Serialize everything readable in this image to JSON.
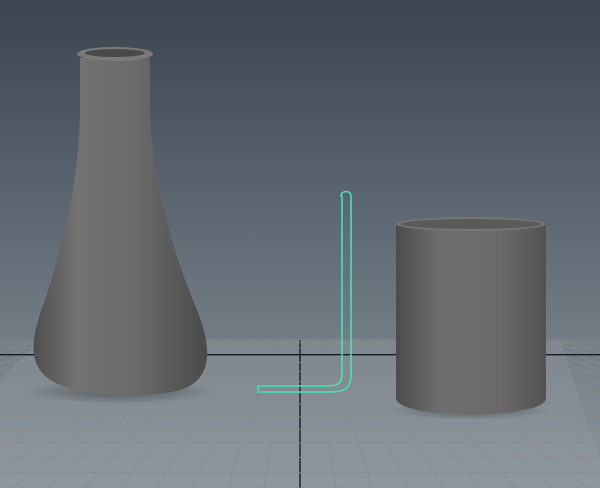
{
  "viewport": {
    "background_top": "#3a4550",
    "background_bottom": "#8c959d"
  },
  "grid": {
    "line_color": "#8a8a8a",
    "axis_color": "#1a1a1a"
  },
  "objects": {
    "flask_color": "#6a6a6a",
    "beaker_color": "#666666",
    "selection_color": "#3fe6b0"
  }
}
